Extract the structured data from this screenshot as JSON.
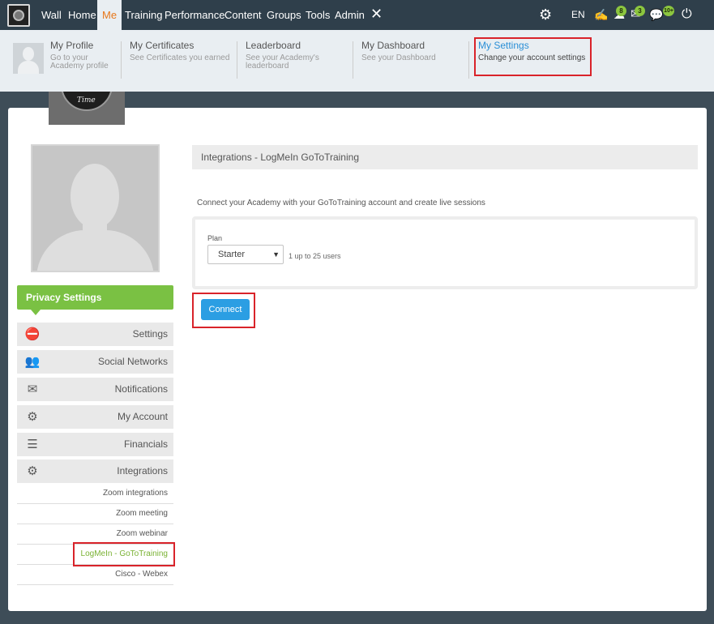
{
  "topnav": {
    "items": [
      "Wall",
      "Home",
      "Me",
      "Training",
      "Performance",
      "Content",
      "Groups",
      "Tools",
      "Admin"
    ],
    "language": "EN",
    "badges": {
      "a": "8",
      "b": "3",
      "c": "10+"
    }
  },
  "submenu": {
    "items": [
      {
        "title": "My Profile",
        "desc": "Go to your Academy profile"
      },
      {
        "title": "My Certificates",
        "desc": "See Certificates you earned"
      },
      {
        "title": "Leaderboard",
        "desc": "See your Academy's leaderboard"
      },
      {
        "title": "My Dashboard",
        "desc": "See your Dashboard"
      },
      {
        "title": "My Settings",
        "desc": "Change your account settings"
      }
    ]
  },
  "academy_logo_text": "Time",
  "sidebar": {
    "header": "Privacy Settings",
    "items": [
      "Settings",
      "Social Networks",
      "Notifications",
      "My Account",
      "Financials",
      "Integrations"
    ],
    "sub_items": [
      "Zoom integrations",
      "Zoom meeting",
      "Zoom webinar",
      "LogMeIn - GoToTraining",
      "Cisco - Webex"
    ]
  },
  "content": {
    "title": "Integrations - LogMeIn GoToTraining",
    "description": "Connect your Academy with your GoToTraining account and create live sessions",
    "plan_label": "Plan",
    "plan_value": "Starter",
    "plan_note": "1 up to 25 users",
    "connect_label": "Connect"
  },
  "colors": {
    "accent": "#7ac143",
    "link": "#2b9ee3",
    "nav": "#2f3f4b",
    "highlight": "#d9232a"
  }
}
